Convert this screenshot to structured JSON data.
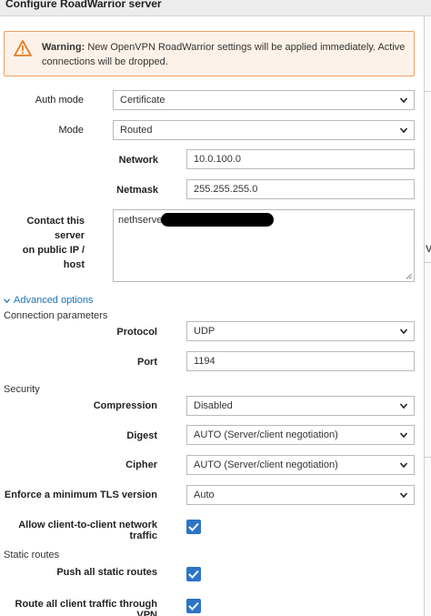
{
  "dialog": {
    "title": "Configure RoadWarrior server"
  },
  "warning": {
    "prefix": "Warning:",
    "message": "New OpenVPN RoadWarrior settings will be applied immediately. Active connections will be dropped.",
    "icon": "warning-triangle-icon",
    "colors": {
      "background": "#fdf2e9",
      "border": "#f0a063",
      "icon": "#e67e22"
    }
  },
  "form": {
    "auth_mode": {
      "label": "Auth mode",
      "value": "Certificate"
    },
    "mode": {
      "label": "Mode",
      "value": "Routed"
    },
    "network": {
      "label": "Network",
      "value": "10.0.100.0"
    },
    "netmask": {
      "label": "Netmask",
      "value": "255.255.255.0"
    },
    "contact": {
      "label_line1": "Contact this server",
      "label_line2": "on public IP / host",
      "value": "nethserver"
    }
  },
  "advanced": {
    "toggle_label": "Advanced options",
    "connection_section": "Connection parameters",
    "protocol": {
      "label": "Protocol",
      "value": "UDP"
    },
    "port": {
      "label": "Port",
      "value": "1194"
    },
    "security_section": "Security",
    "compression": {
      "label": "Compression",
      "value": "Disabled"
    },
    "digest": {
      "label": "Digest",
      "value": "AUTO (Server/client negotiation)"
    },
    "cipher": {
      "label": "Cipher",
      "value": "AUTO (Server/client negotiation)"
    },
    "tls": {
      "label": "Enforce a minimum TLS version",
      "value": "Auto"
    },
    "client_to_client": {
      "label": "Allow client-to-client network traffic",
      "checked": true
    },
    "static_routes_section": "Static routes",
    "push_routes": {
      "label": "Push all static routes",
      "checked": true
    },
    "route_all": {
      "label": "Route all client traffic through VPN",
      "checked": true
    }
  },
  "background_window": {
    "partial_text": "V"
  },
  "colors": {
    "accent": "#1b73b9",
    "checkbox": "#2c74c6"
  }
}
